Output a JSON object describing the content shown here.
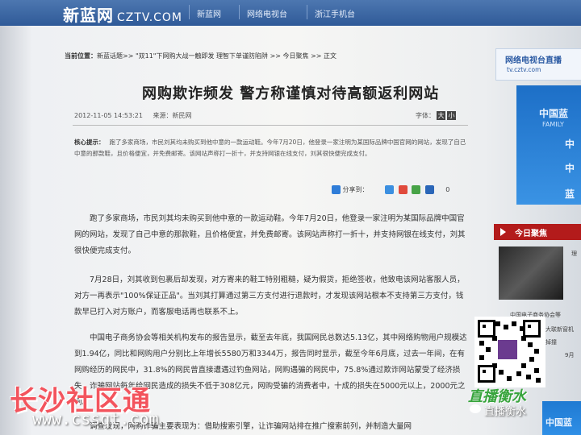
{
  "header": {
    "logo_cn": "新蓝网",
    "logo_domain": "CZTV.COM",
    "nav": [
      "新蓝网",
      "网络电视台",
      "浙江手机台"
    ]
  },
  "breadcrumb": {
    "label": "当前位置：",
    "path": "新蓝话题>> \"双11\"下网购大战一触即发 理智下单谨防陷阱 >> 今日聚焦 >> 正文"
  },
  "article": {
    "title": "网购欺诈频发 警方称谨慎对待高额返利网站",
    "datetime": "2012-11-05 14:53:21",
    "source": "来源：新民网",
    "font_label": "字体：",
    "font_large": "大",
    "font_small": "小",
    "summary_label": "核心提示：",
    "summary": "跑了多家商场，市民刘其均未购买到他中意的一款运动鞋。今年7月20日，他登录一家注明为某国际品牌中国官网的网站，发现了自己中意的那款鞋，且价格便宜，并免费邮寄。该网站声称打一折十，并支持网银在线支付，刘其很快便完成支付。",
    "share_label": "分享到：",
    "share_count": "0",
    "paragraphs": [
      "跑了多家商场，市民刘其均未购买到他中意的一款运动鞋。今年7月20日，他登录一家注明为某国际品牌中国官网的网站，发现了自己中意的那款鞋，且价格便宜，并免费邮寄。该网站声称打一折十，并支持网银在线支付，刘其很快便完成支付。",
      "7月28日，刘其收到包裹后却发现，对方寄来的鞋工特别粗糙，疑为假货，拒绝签收，他致电该网站客服人员，对方一再表示\"100%保证正品\"。当刘其打算通过第三方支付进行退款时，才发现该网站根本不支持第三方支付，钱款早已打入对方账户，而客服电话再也联系不上。",
      "中国电子商务协会等相关机构发布的报告显示，截至去年底，我国网民总数达5.13亿，其中网络购物用户规模达到1.94亿，同比和网购用户分别比上年增长5580万和3344万，报告同时显示，截至今年6月底，过去一年间，在有网购经历的网民中，31.8%的网民曾直接遭遇过钓鱼网站，网购遇骗的网民中，75.8%通过欺诈网站蒙受了经济损失，诈骗网站每年给网民造成的损失不低于308亿元，网购受骗的消费者中，十成的损失在5000元以上，2000元之间。",
      "调查发现，网购诈骗主要表现为：借助搜索引擎，让诈骗网站排在推广搜索前列，并制造大量网"
    ]
  },
  "sidebar": {
    "tv_title": "网络电视台直播",
    "tv_url": "tv.cztv.com",
    "ad_lines": [
      "中国蓝",
      "FAMILY",
      "中",
      "中",
      "蓝"
    ],
    "today_label": "今日聚焦",
    "items": [
      "理",
      "中国电子商务协会等",
      "大联新窗机",
      "掉撞",
      "9月"
    ],
    "bottom_ad": "中国蓝"
  },
  "overlay": {
    "watermark_cn": "长沙社区通",
    "watermark_url": "www.cssqt.com",
    "live_logo": "直播衡水",
    "wechat_name": "直播衡水"
  },
  "colors": {
    "nav_blue": "#2f5a98",
    "accent_red": "#b31b1b",
    "watermark_red": "#f3545d",
    "live_green": "#37a43c"
  }
}
